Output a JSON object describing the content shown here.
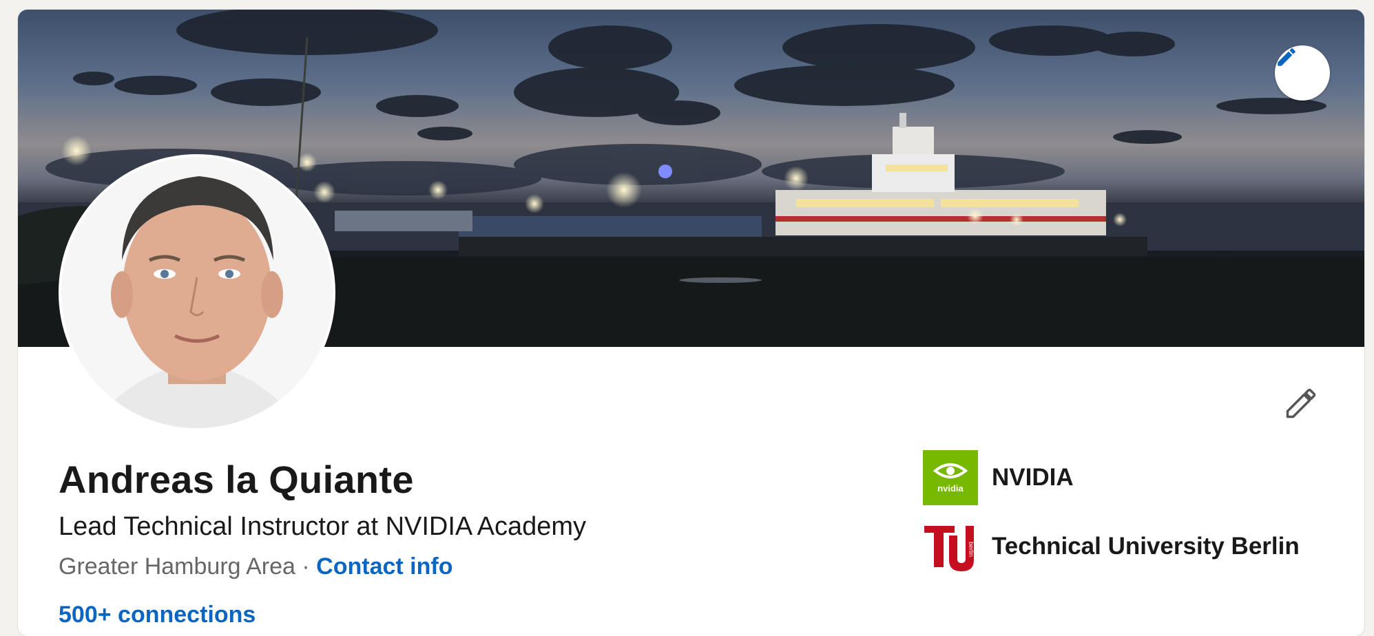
{
  "profile": {
    "name": "Andreas la Quiante",
    "headline": "Lead Technical Instructor at NVIDIA Academy",
    "location": "Greater Hamburg Area",
    "separator": "·",
    "contact_info_label": "Contact info",
    "connections_label": "500+ connections"
  },
  "organizations": [
    {
      "name": "NVIDIA",
      "logo_text": "nvidia",
      "icon": "nvidia-logo"
    },
    {
      "name": "Technical University Berlin",
      "logo_text": "berlin",
      "icon": "tu-berlin-logo"
    }
  ],
  "icons": {
    "banner_edit": "pencil-icon",
    "intro_edit": "pencil-icon"
  },
  "colors": {
    "accent": "#0a66c2",
    "nvidia_green": "#76b900",
    "tu_red": "#c50e1f",
    "text_primary": "#191919",
    "text_secondary": "#666666"
  }
}
